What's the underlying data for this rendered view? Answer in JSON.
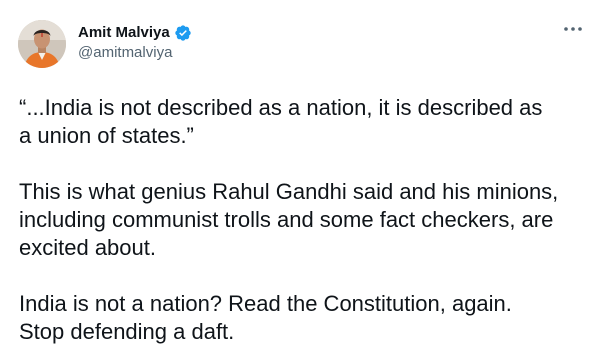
{
  "author": {
    "display_name": "Amit Malviya",
    "handle": "@amitmalviya",
    "verified": true,
    "avatar": "avatar-photo",
    "verified_icon": "verified-badge-icon",
    "accent_color": "#1d9bf0"
  },
  "menu": {
    "icon": "more-options-icon"
  },
  "tweet": {
    "paragraphs": [
      "“...India is not described as a nation, it is described as\na union of states.”",
      "This is what genius Rahul Gandhi said and his minions,\nincluding communist trolls and some fact checkers, are\nexcited about.",
      "India is not a nation? Read the Constitution, again.\nStop defending a daft."
    ]
  }
}
